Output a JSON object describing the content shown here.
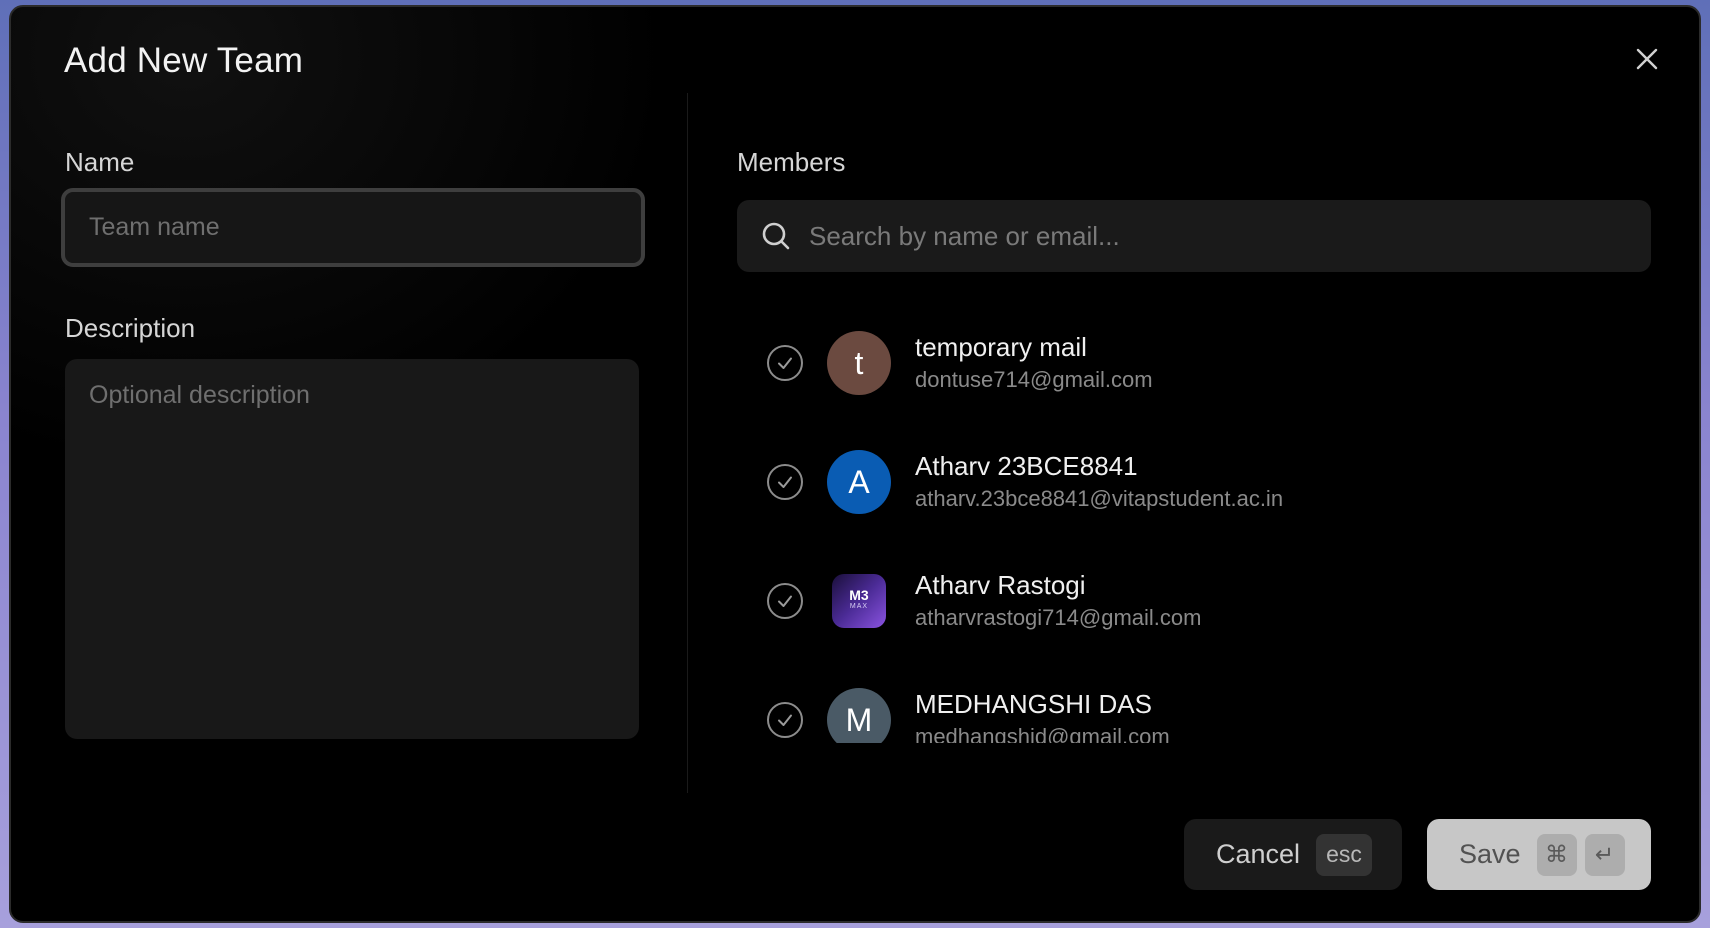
{
  "dialog": {
    "title": "Add New Team"
  },
  "form": {
    "name_label": "Name",
    "name_placeholder": "Team name",
    "description_label": "Description",
    "description_placeholder": "Optional description"
  },
  "members": {
    "label": "Members",
    "search_placeholder": "Search by name or email...",
    "items": [
      {
        "name": "temporary mail",
        "email": "dontuse714@gmail.com",
        "initial": "t",
        "avatar_color": "#6b4a40",
        "selected": false
      },
      {
        "name": "Atharv 23BCE8841",
        "email": "atharv.23bce8841@vitapstudent.ac.in",
        "initial": "A",
        "avatar_color": "#0a5cb3",
        "selected": false
      },
      {
        "name": "Atharv Rastogi",
        "email": "atharvrastogi714@gmail.com",
        "avatar_chip": "M3",
        "avatar_sub": "MAX",
        "selected": false
      },
      {
        "name": "MEDHANGSHI DAS",
        "email": "medhangshid@gmail.com",
        "initial": "M",
        "avatar_color": "#4a5a66",
        "selected": false
      }
    ]
  },
  "actions": {
    "cancel_label": "Cancel",
    "cancel_shortcut": "esc",
    "save_label": "Save",
    "save_shortcut_cmd": "⌘",
    "save_shortcut_enter": "↵"
  },
  "colors": {
    "dialog_bg": "#000000",
    "input_bg": "#181818",
    "save_bg": "#c7c7c7"
  }
}
